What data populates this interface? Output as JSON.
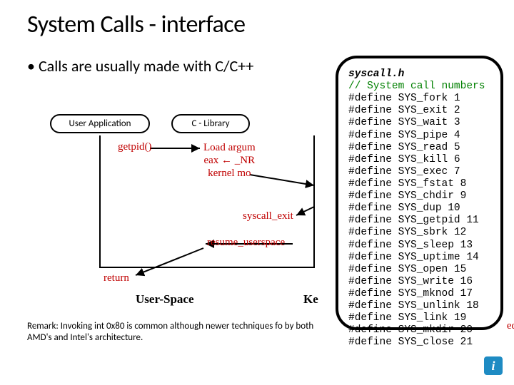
{
  "title": "System Calls - interface",
  "bullet": "Calls are usually made with C/C++",
  "diagram": {
    "user_app": "User Application",
    "c_lib": "C - Library",
    "getpid": "getpid()",
    "load_args_l1": "Load argum",
    "load_args_l2": "eax ← _NR",
    "load_args_l3": "kernel mo",
    "syscall_exit": "syscall_exit",
    "resume": "resume_userspace",
    "return": "return",
    "user_space": "User-Space",
    "kernel_space": "Ke"
  },
  "remark": "Remark: Invoking int 0x80 is common although newer techniques fo\nby both AMD's and Intel's architecture.",
  "code": {
    "file": "syscall.h",
    "comment": "// System call numbers",
    "defs": [
      "#define SYS_fork 1",
      "#define SYS_exit 2",
      "#define SYS_wait 3",
      "#define SYS_pipe 4",
      "#define SYS_read 5",
      "#define SYS_kill 6",
      "#define SYS_exec 7",
      "#define SYS_fstat 8",
      "#define SYS_chdir 9",
      "#define SYS_dup 10",
      "#define SYS_getpid 11",
      "#define SYS_sbrk 12",
      "#define SYS_sleep 13",
      "#define SYS_uptime 14",
      "#define SYS_open 15",
      "#define SYS_write 16",
      "#define SYS_mknod 17",
      "#define SYS_unlink 18",
      "#define SYS_link 19",
      "#define SYS_mkdir 20",
      "#define SYS_close 21"
    ]
  },
  "ed_hint": "ed"
}
